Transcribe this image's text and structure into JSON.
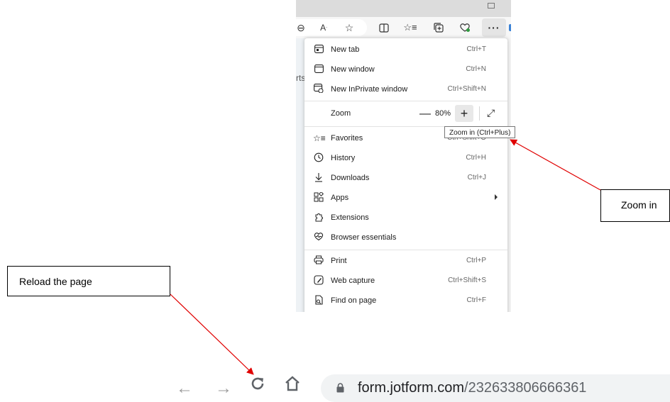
{
  "menu": {
    "items": [
      {
        "icon": "new-tab-icon",
        "label": "New tab",
        "shortcut": "Ctrl+T"
      },
      {
        "icon": "new-window-icon",
        "label": "New window",
        "shortcut": "Ctrl+N"
      },
      {
        "icon": "inprivate-icon",
        "label": "New InPrivate window",
        "shortcut": "Ctrl+Shift+N"
      }
    ],
    "zoom": {
      "label": "Zoom",
      "minus": "—",
      "value": "80%",
      "plus": "+",
      "fullscreen": "⤢"
    },
    "items2": [
      {
        "icon": "favorites-icon",
        "label": "Favorites",
        "shortcut": "Ctrl+Shift+O"
      },
      {
        "icon": "history-icon",
        "label": "History",
        "shortcut": "Ctrl+H"
      },
      {
        "icon": "downloads-icon",
        "label": "Downloads",
        "shortcut": "Ctrl+J"
      },
      {
        "icon": "apps-icon",
        "label": "Apps",
        "shortcut": ""
      },
      {
        "icon": "extensions-icon",
        "label": "Extensions",
        "shortcut": ""
      },
      {
        "icon": "browser-essentials-icon",
        "label": "Browser essentials",
        "shortcut": ""
      }
    ],
    "items3": [
      {
        "icon": "print-icon",
        "label": "Print",
        "shortcut": "Ctrl+P"
      },
      {
        "icon": "web-capture-icon",
        "label": "Web capture",
        "shortcut": "Ctrl+Shift+S"
      },
      {
        "icon": "find-on-page-icon",
        "label": "Find on page",
        "shortcut": "Ctrl+F"
      }
    ]
  },
  "page_fragment": "rts",
  "tooltip": "Zoom in (Ctrl+Plus)",
  "callouts": {
    "zoom_in": "Zoom in",
    "reload": "Reload the page"
  },
  "toolbar": {
    "more": "···"
  },
  "nav": {
    "back": "←",
    "forward": "→",
    "reload": "C"
  },
  "address": {
    "domain": "form.jotform.com",
    "path": "/232633806666361"
  },
  "colors": {
    "arrow": "#e00000",
    "url_path": "#5f6368",
    "accent": "#3b82d6"
  }
}
